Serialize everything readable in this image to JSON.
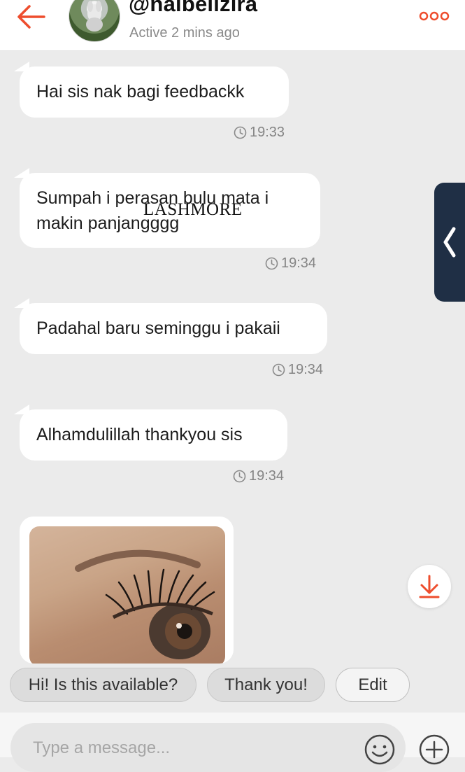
{
  "header": {
    "username": "@naibellzira",
    "status": "Active 2 mins ago"
  },
  "messages": [
    {
      "lines": [
        "Hai sis nak bagi feedbackk"
      ],
      "time": "19:33"
    },
    {
      "lines": [
        "Sumpah i perasan bulu mata i",
        "makin panjangggg"
      ],
      "time": "19:34"
    },
    {
      "lines": [
        "Padahal baru seminggu i pakaii"
      ],
      "time": "19:34"
    },
    {
      "lines": [
        "Alhamdulillah thankyou sis"
      ],
      "time": "19:34"
    }
  ],
  "watermark": "LASHMORE",
  "quick_replies": [
    "Hi! Is this available?",
    "Thank you!",
    "Edit"
  ],
  "composer": {
    "placeholder": "Type a message..."
  },
  "colors": {
    "accent": "#ee4d2d",
    "side_handle": "#1f2f45",
    "bubble": "#ffffff",
    "background": "#ebebeb"
  },
  "icons": [
    "back-arrow-icon",
    "more-dots-icon",
    "clock-icon",
    "chevron-left-icon",
    "download-arrow-icon",
    "emoji-icon",
    "plus-circle-icon"
  ]
}
